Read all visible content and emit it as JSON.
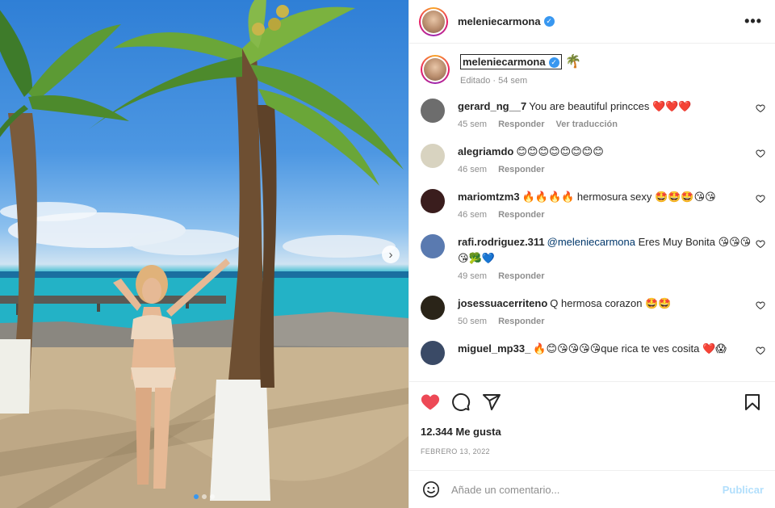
{
  "post": {
    "username": "meleniecarmona",
    "caption_emoji": "🌴",
    "caption_meta": "Editado · 54 sem",
    "likes": "12.344 Me gusta",
    "date": "FEBRERO 13, 2022",
    "carousel_pages": 3,
    "carousel_active": 1
  },
  "comments": [
    {
      "user": "gerard_ng__7",
      "text": "You are beautiful princces ❤️❤️❤️",
      "time": "45 sem",
      "reply": "Responder",
      "translate": "Ver traducción",
      "avatar_color": "#6d6d6d"
    },
    {
      "user": "alegriamdo",
      "text": "😊😊😊😊😊😊😊😊",
      "time": "46 sem",
      "reply": "Responder",
      "avatar_color": "#d8d3c0"
    },
    {
      "user": "mariomtzm3",
      "text": "🔥🔥🔥🔥 hermosura sexy 🤩🤩🤩😘😘",
      "time": "46 sem",
      "reply": "Responder",
      "avatar_color": "#3a1d1d"
    },
    {
      "user": "rafi.rodriguez.311",
      "mention": "@meleniecarmona",
      "text": "Eres Muy Bonita 😘😘😘😘🥦💙",
      "time": "49 sem",
      "reply": "Responder",
      "avatar_color": "#5a7ab0"
    },
    {
      "user": "josessuacerriteno",
      "text": "Q hermosa corazon 🤩🤩",
      "time": "50 sem",
      "reply": "Responder",
      "avatar_color": "#2a2418"
    },
    {
      "user": "miguel_mp33_",
      "text": "🔥😊😘😘😘😘que rica te ves cosita ❤️😱",
      "time": "",
      "reply": "",
      "avatar_color": "#3a4a66"
    }
  ],
  "labels": {
    "more": "•••",
    "add_comment_placeholder": "Añade un comentario...",
    "publish": "Publicar",
    "next": "›"
  },
  "colors": {
    "liked_heart": "#ed4956",
    "verified": "#3897f0",
    "publish_disabled": "#b2dffc"
  }
}
